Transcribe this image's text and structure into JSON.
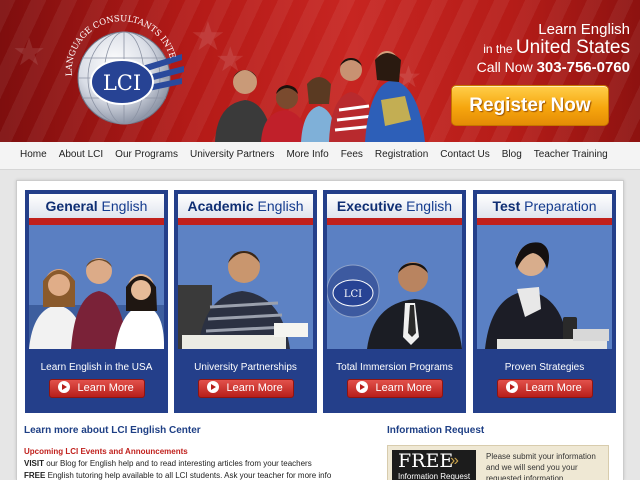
{
  "header": {
    "top_links": "",
    "logo": {
      "arc_text": "LANGUAGE CONSULTANTS INTERNATIONAL",
      "initials": "LCI"
    },
    "tagline": {
      "line1": "Learn English",
      "line2_prefix": "in the",
      "line2_emph": "United States",
      "line3_prefix": "Call Now",
      "line3_phone": "303-756-0760"
    },
    "register_label": "Register Now"
  },
  "nav": [
    "Home",
    "About LCI",
    "Our Programs",
    "University Partners",
    "More Info",
    "Fees",
    "Registration",
    "Contact Us",
    "Blog",
    "Teacher Training"
  ],
  "cards": [
    {
      "title_bold": "General",
      "title_rest": " English",
      "subtitle": "Learn English in the USA",
      "button": "Learn More"
    },
    {
      "title_bold": "Academic",
      "title_rest": " English",
      "subtitle": "University Partnerships",
      "button": "Learn More"
    },
    {
      "title_bold": "Executive",
      "title_rest": " English",
      "subtitle": "Total Immersion Programs",
      "button": "Learn More",
      "photo_badge": "LCI"
    },
    {
      "title_bold": "Test",
      "title_rest": " Preparation",
      "subtitle": "Proven Strategies",
      "button": "Learn More"
    }
  ],
  "content": {
    "learn_heading": "Learn more about LCI English Center",
    "events_heading": "Upcoming LCI Events and Announcements",
    "line1_bold": "VISIT",
    "line1_rest": " our Blog for English help and to read interesting articles from your teachers",
    "line2_bold": "FREE",
    "line2_rest": " English tutoring help available to all LCI students.  Ask your teacher for more info"
  },
  "info_request": {
    "heading": "Information Request",
    "badge_big": "FREE",
    "badge_small": "Information Request",
    "text": "Please submit your information and we will send you your requested information."
  },
  "colors": {
    "brand_red": "#c0201c",
    "brand_blue": "#243f8a",
    "register_orange": "#f6a60e"
  }
}
